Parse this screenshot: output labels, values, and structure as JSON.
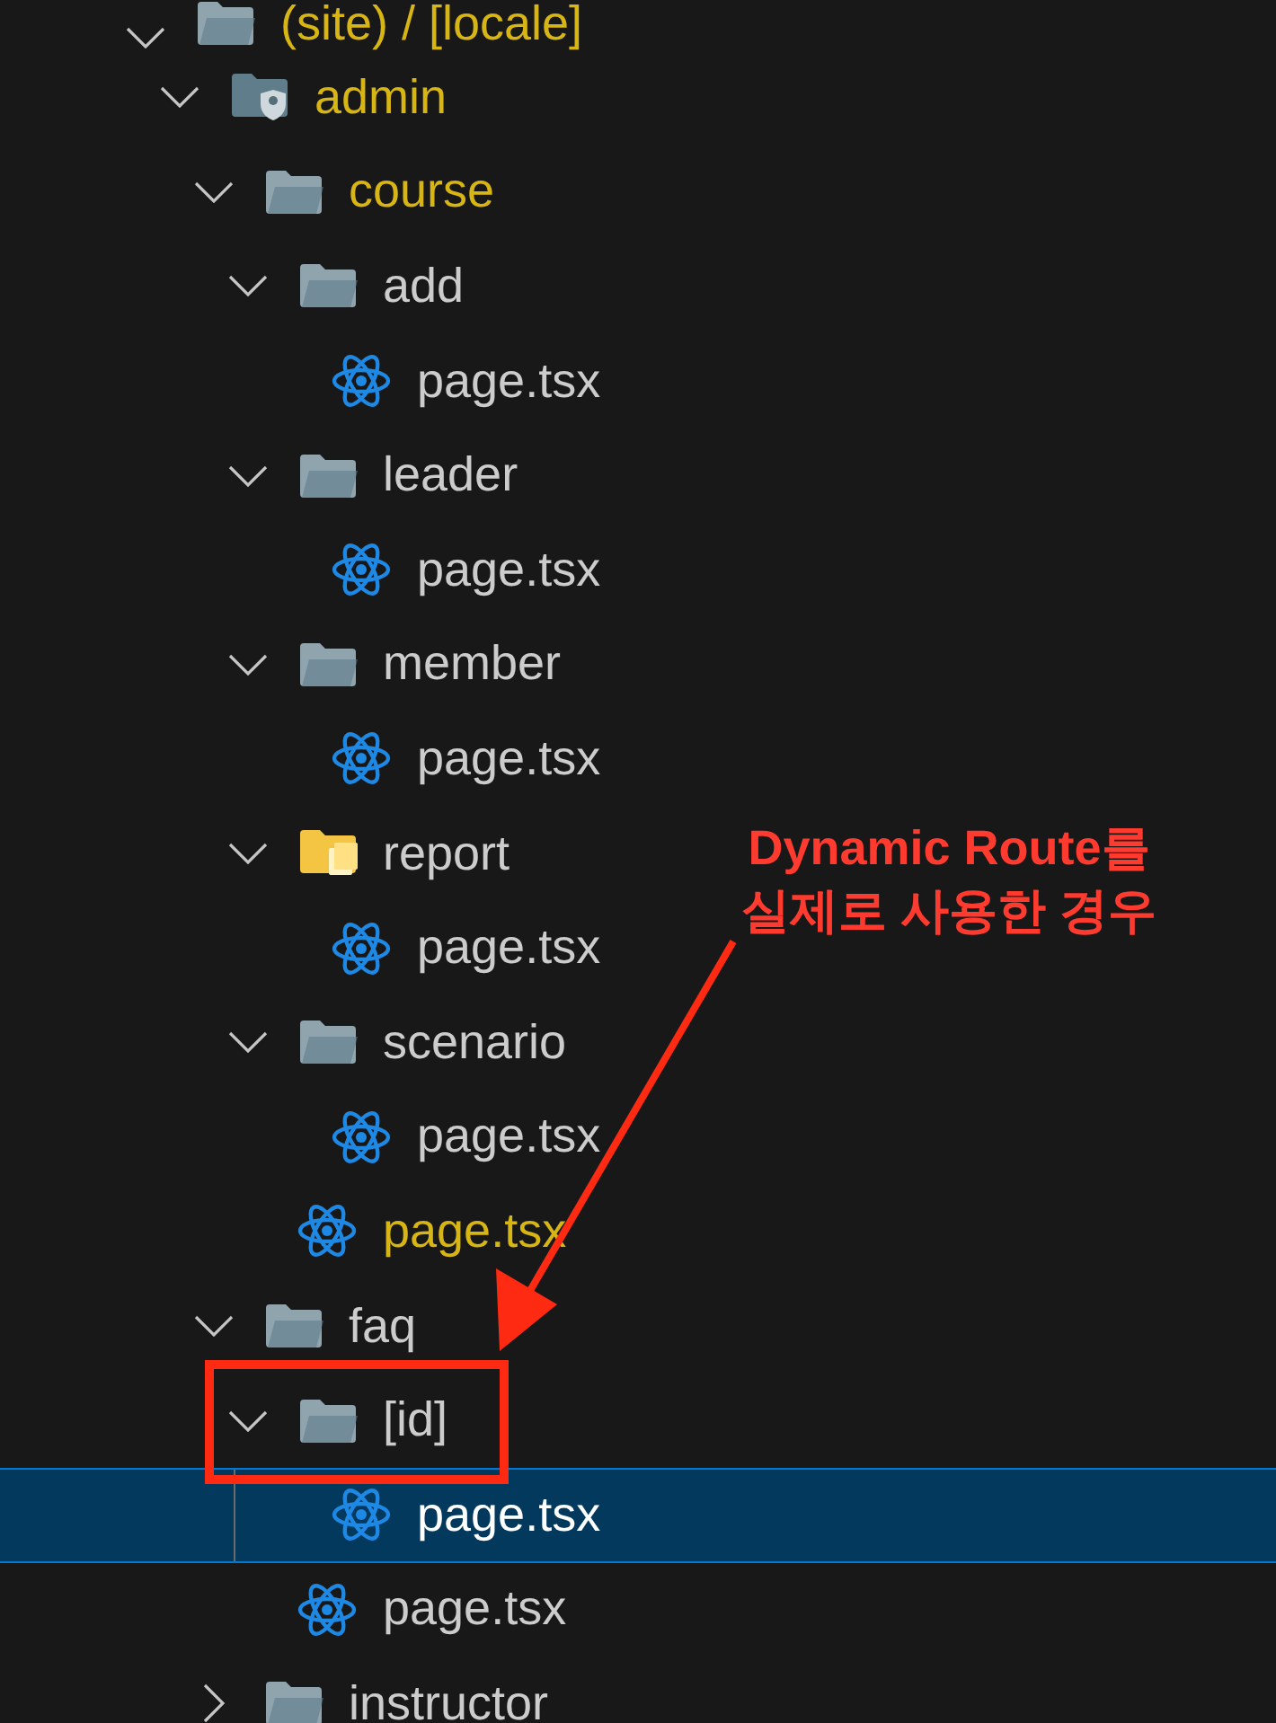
{
  "tree": [
    {
      "name": "(site) / [locale]",
      "kind": "folder",
      "expanded": true,
      "modified": true,
      "selected": false,
      "children": [
        {
          "name": "admin",
          "kind": "admin-folder",
          "expanded": true,
          "modified": true,
          "selected": false,
          "children": [
            {
              "name": "course",
              "kind": "folder",
              "expanded": true,
              "modified": true,
              "selected": false,
              "children": [
                {
                  "name": "add",
                  "kind": "folder",
                  "expanded": true,
                  "modified": false,
                  "selected": false,
                  "children": [
                    {
                      "name": "page.tsx",
                      "kind": "file",
                      "modified": false,
                      "selected": false
                    }
                  ]
                },
                {
                  "name": "leader",
                  "kind": "folder",
                  "expanded": true,
                  "modified": false,
                  "selected": false,
                  "children": [
                    {
                      "name": "page.tsx",
                      "kind": "file",
                      "modified": false,
                      "selected": false
                    }
                  ]
                },
                {
                  "name": "member",
                  "kind": "folder",
                  "expanded": true,
                  "modified": false,
                  "selected": false,
                  "children": [
                    {
                      "name": "page.tsx",
                      "kind": "file",
                      "modified": false,
                      "selected": false
                    }
                  ]
                },
                {
                  "name": "report",
                  "kind": "report-folder",
                  "expanded": true,
                  "modified": false,
                  "selected": false,
                  "children": [
                    {
                      "name": "page.tsx",
                      "kind": "file",
                      "modified": false,
                      "selected": false
                    }
                  ]
                },
                {
                  "name": "scenario",
                  "kind": "folder",
                  "expanded": true,
                  "modified": false,
                  "selected": false,
                  "children": [
                    {
                      "name": "page.tsx",
                      "kind": "file",
                      "modified": false,
                      "selected": false
                    }
                  ]
                },
                {
                  "name": "page.tsx",
                  "kind": "file",
                  "modified": true,
                  "selected": false
                }
              ]
            },
            {
              "name": "faq",
              "kind": "folder",
              "expanded": true,
              "modified": false,
              "selected": false,
              "children": [
                {
                  "name": "[id]",
                  "kind": "folder",
                  "expanded": true,
                  "modified": false,
                  "selected": false,
                  "children": [
                    {
                      "name": "page.tsx",
                      "kind": "file",
                      "modified": false,
                      "selected": true
                    }
                  ]
                },
                {
                  "name": "page.tsx",
                  "kind": "file",
                  "modified": false,
                  "selected": false
                }
              ]
            },
            {
              "name": "instructor",
              "kind": "folder",
              "expanded": false,
              "modified": false,
              "selected": false
            }
          ]
        }
      ]
    }
  ],
  "annotation": {
    "text": "Dynamic Route를 실제로 사용한 경우"
  }
}
